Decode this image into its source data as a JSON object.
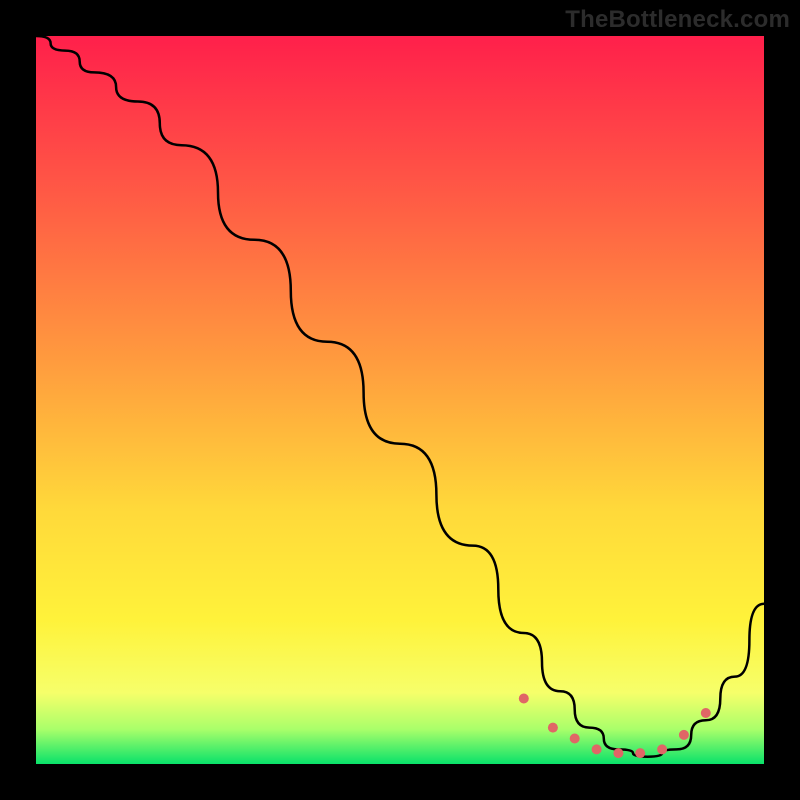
{
  "watermark": "TheBottleneck.com",
  "chart_data": {
    "type": "line",
    "title": "",
    "xlabel": "",
    "ylabel": "",
    "xlim": [
      0,
      100
    ],
    "ylim": [
      0,
      100
    ],
    "grid": false,
    "gradient_stops": [
      {
        "offset": 0,
        "color": "#ff1f4b"
      },
      {
        "offset": 22,
        "color": "#ff5a45"
      },
      {
        "offset": 45,
        "color": "#ff9c3e"
      },
      {
        "offset": 65,
        "color": "#ffd93a"
      },
      {
        "offset": 80,
        "color": "#fff23a"
      },
      {
        "offset": 90,
        "color": "#f6ff6a"
      },
      {
        "offset": 95,
        "color": "#a9ff6a"
      },
      {
        "offset": 100,
        "color": "#00e06a"
      }
    ],
    "series": [
      {
        "name": "bottleneck-curve",
        "color": "#000000",
        "x": [
          0,
          4,
          8,
          14,
          20,
          30,
          40,
          50,
          60,
          67,
          72,
          76,
          80,
          84,
          88,
          92,
          96,
          100
        ],
        "y": [
          100,
          98,
          95,
          91,
          85,
          72,
          58,
          44,
          30,
          18,
          10,
          5,
          2,
          1,
          2,
          6,
          12,
          22
        ]
      }
    ],
    "highlight": {
      "name": "optimal-zone",
      "color": "#e06666",
      "marker_size": 5,
      "x": [
        67,
        71,
        74,
        77,
        80,
        83,
        86,
        89,
        92
      ],
      "y": [
        9,
        5,
        3.5,
        2,
        1.5,
        1.5,
        2,
        4,
        7
      ]
    }
  }
}
